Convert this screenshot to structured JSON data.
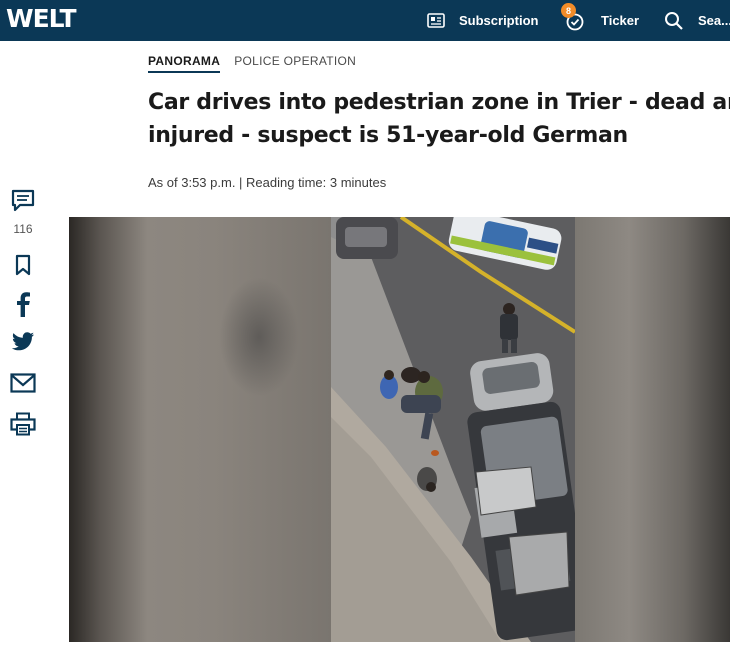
{
  "header": {
    "logo": "WELT",
    "nav": {
      "subscription": "Subscription",
      "ticker": "Ticker",
      "ticker_badge": "8",
      "search": "Sea..."
    }
  },
  "article": {
    "section": "PANORAMA",
    "topic": "POLICE OPERATION",
    "headline_line1": "Car drives into pedestrian zone in Trier - dead and",
    "headline_line2": "injured - suspect is 51-year-old German",
    "meta": "As of 3:53 p.m. | Reading time: 3 minutes"
  },
  "share": {
    "comment_count": "116",
    "icons": [
      "comment-icon",
      "bookmark-icon",
      "facebook-icon",
      "twitter-icon",
      "mail-icon",
      "print-icon"
    ]
  },
  "colors": {
    "header_bg": "#0b3856",
    "badge": "#f28c28",
    "share_icon": "#0b3856"
  }
}
